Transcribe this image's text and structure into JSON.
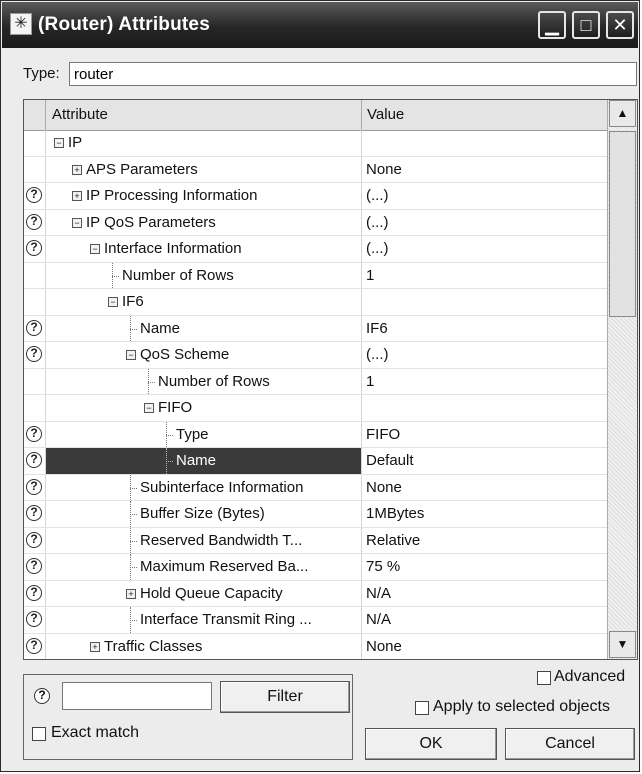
{
  "window": {
    "title": "(Router) Attributes"
  },
  "type_field": {
    "label": "Type:",
    "value": "router"
  },
  "table": {
    "columns": [
      "Attribute",
      "Value"
    ],
    "rows": [
      {
        "name": "IP",
        "value": "",
        "help": false,
        "level": 0,
        "toggle": "minus"
      },
      {
        "name": "APS Parameters",
        "value": "None",
        "help": false,
        "level": 1,
        "toggle": "plus"
      },
      {
        "name": "IP Processing Information",
        "value": "(...)",
        "help": true,
        "level": 1,
        "toggle": "plus"
      },
      {
        "name": "IP QoS Parameters",
        "value": "(...)",
        "help": true,
        "level": 1,
        "toggle": "minus"
      },
      {
        "name": "Interface Information",
        "value": "(...)",
        "help": true,
        "level": 2,
        "toggle": "minus"
      },
      {
        "name": "Number of Rows",
        "value": "1",
        "help": false,
        "level": 3,
        "toggle": "line"
      },
      {
        "name": "IF6",
        "value": "",
        "help": false,
        "level": 3,
        "toggle": "minus"
      },
      {
        "name": "Name",
        "value": "IF6",
        "help": true,
        "level": 4,
        "toggle": "line"
      },
      {
        "name": "QoS Scheme",
        "value": "(...)",
        "help": true,
        "level": 4,
        "toggle": "minus"
      },
      {
        "name": "Number of Rows",
        "value": "1",
        "help": false,
        "level": 5,
        "toggle": "line"
      },
      {
        "name": "FIFO",
        "value": "",
        "help": false,
        "level": 5,
        "toggle": "minus"
      },
      {
        "name": "Type",
        "value": "FIFO",
        "help": true,
        "level": 6,
        "toggle": "line"
      },
      {
        "name": "Name",
        "value": "Default",
        "help": true,
        "level": 6,
        "toggle": "line",
        "selected": true
      },
      {
        "name": "Subinterface Information",
        "value": "None",
        "help": true,
        "level": 4,
        "toggle": "line"
      },
      {
        "name": "Buffer Size (Bytes)",
        "value": "1MBytes",
        "help": true,
        "level": 4,
        "toggle": "line"
      },
      {
        "name": "Reserved Bandwidth T...",
        "value": "Relative",
        "help": true,
        "level": 4,
        "toggle": "line"
      },
      {
        "name": "Maximum Reserved Ba...",
        "value": "75 %",
        "help": true,
        "level": 4,
        "toggle": "line"
      },
      {
        "name": "Hold Queue Capacity",
        "value": "N/A",
        "help": true,
        "level": 4,
        "toggle": "plus"
      },
      {
        "name": "Interface Transmit Ring ...",
        "value": "N/A",
        "help": true,
        "level": 4,
        "toggle": "line"
      },
      {
        "name": "Traffic Classes",
        "value": "None",
        "help": true,
        "level": 2,
        "toggle": "plus"
      }
    ]
  },
  "filter": {
    "help_glyph": "?",
    "search_value": "",
    "filter_button": "Filter",
    "exact_match_label": "Exact match"
  },
  "options": {
    "advanced_label": "Advanced",
    "apply_label": "Apply to selected objects"
  },
  "buttons": {
    "ok": "OK",
    "cancel": "Cancel"
  },
  "icons": {
    "app": "asterisk-icon",
    "minimize": "minimize-icon",
    "maximize": "maximize-icon",
    "close": "close-icon",
    "help": "question-circle-icon",
    "expand": "plus-box-icon",
    "collapse": "minus-box-icon"
  }
}
